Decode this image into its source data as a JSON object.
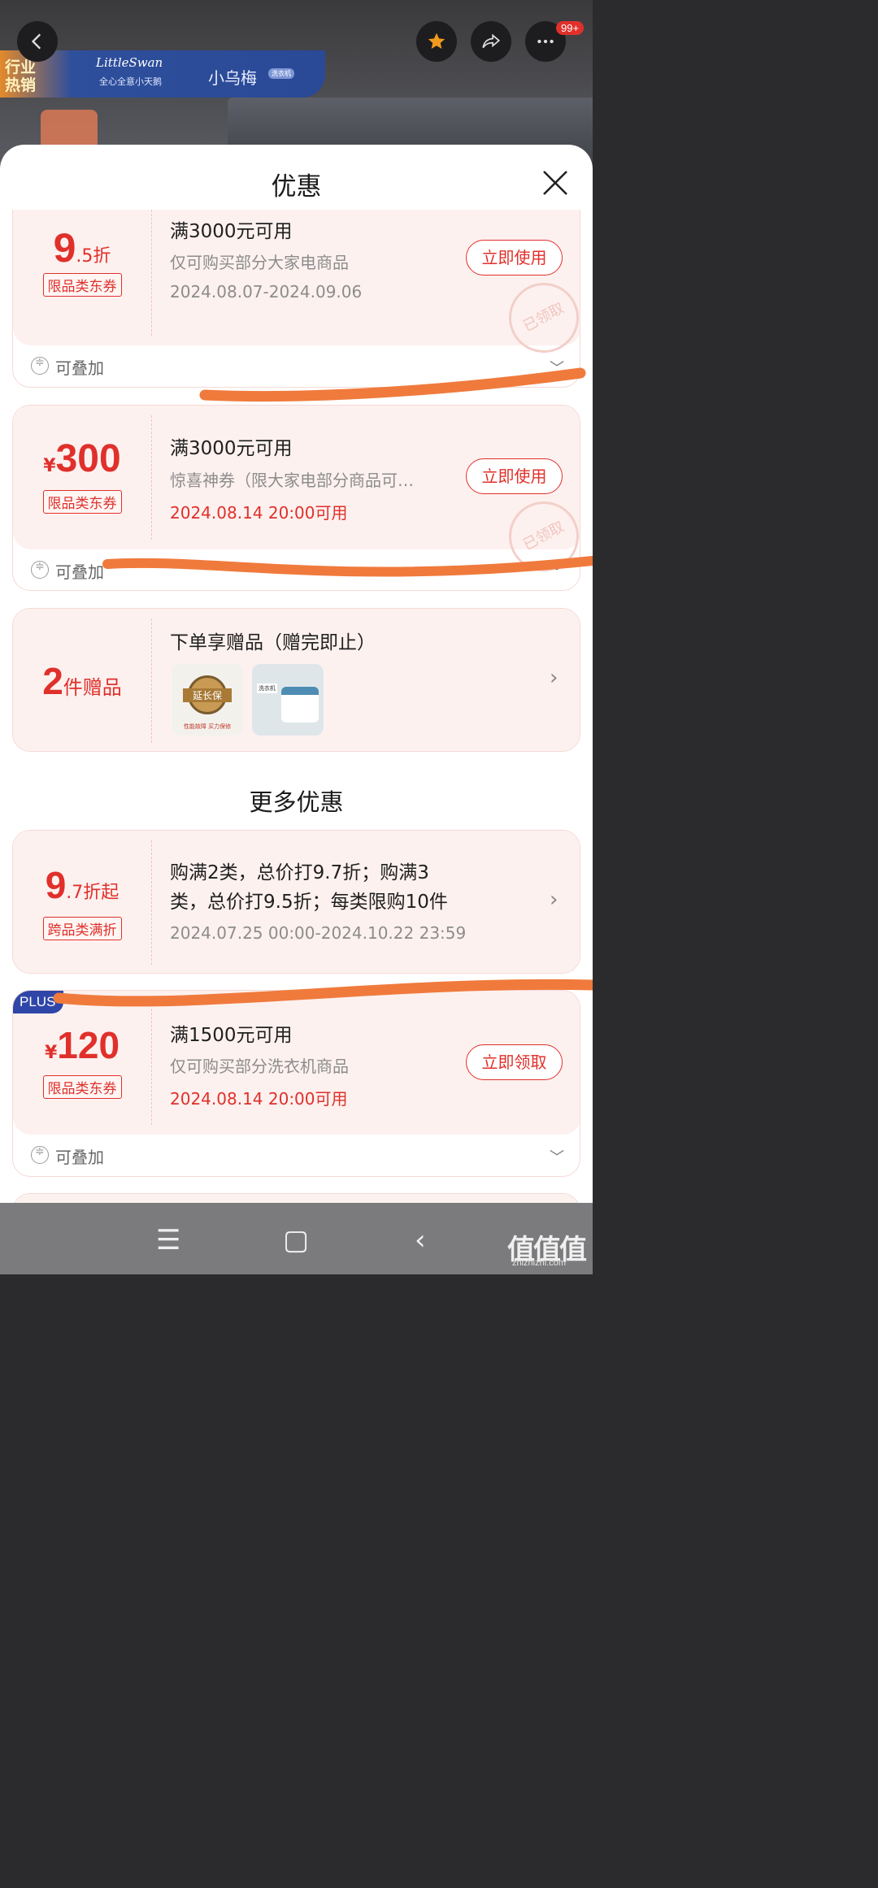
{
  "backdrop": {
    "hot_tag": "行业热销",
    "brand1": "LittleSwan",
    "brand1_sub": "全心全意小天鹅",
    "brand2": "小乌梅",
    "brand2_badge": "洗衣机"
  },
  "top_bar": {
    "notif_badge": "99+"
  },
  "sheet": {
    "title": "优惠"
  },
  "coupons": [
    {
      "amount_main": "9",
      "amount_suffix": ".5折",
      "tag": "限品类东券",
      "condition": "满3000元可用",
      "description": "仅可购买部分大家电商品",
      "date": "2024.08.07-2024.09.06",
      "button": "立即使用",
      "stamp": "已领取",
      "stack_label": "可叠加"
    },
    {
      "amount_prefix": "¥",
      "amount_main": "300",
      "tag": "限品类东券",
      "condition": "满3000元可用",
      "description": "惊喜神券（限大家电部分商品可…",
      "date": "2024.08.14 20:00可用",
      "button": "立即使用",
      "stamp": "已领取",
      "stack_label": "可叠加"
    }
  ],
  "gift": {
    "count": "2",
    "unit": "件赠品",
    "title": "下单享赠品（赠完即止）",
    "thumb1_text": "延长保",
    "thumb1_sub": "性能故障  买力保修",
    "thumb2_text": "洗衣机"
  },
  "more": {
    "title": "更多优惠",
    "discount": {
      "amount_main": "9",
      "amount_suffix": ".7折起",
      "tag": "跨品类满折",
      "line1": "购满2类，总价打9.7折；购满3",
      "line2": "类，总价打9.5折；每类限购10件",
      "date": "2024.07.25 00:00-2024.10.22 23:59"
    },
    "plus_coupon": {
      "badge": "PLUS",
      "amount_prefix": "¥",
      "amount_main": "120",
      "tag": "限品类东券",
      "condition": "满1500元可用",
      "description": "仅可购买部分洗衣机商品",
      "date": "2024.08.14 20:00可用",
      "button": "立即领取",
      "stack_label": "可叠加"
    }
  },
  "watermark": {
    "main": "值值值",
    "sub": "zhizhizhi.com"
  },
  "colors": {
    "accent": "#e0302b",
    "card_bg": "#fdf1ef",
    "scribble": "#f07a3c",
    "plus": "#2f46a8"
  }
}
